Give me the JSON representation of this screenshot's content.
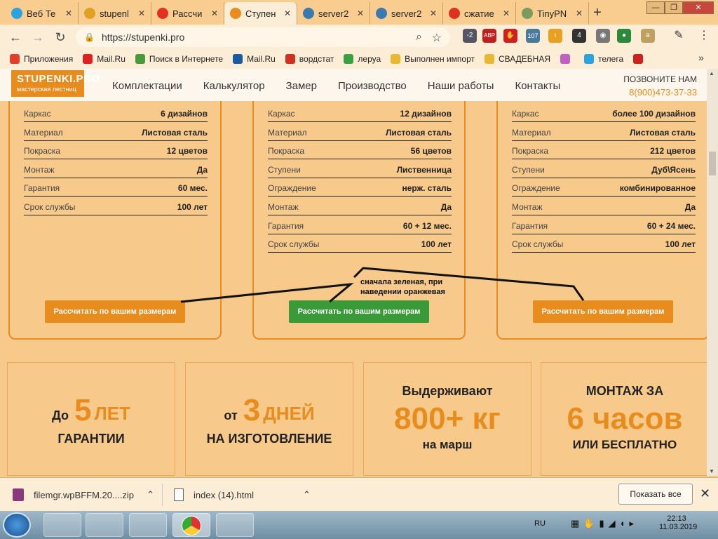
{
  "browser": {
    "tabs": [
      {
        "title": "Веб Те",
        "color": "#2aa3e0"
      },
      {
        "title": "stupenl",
        "color": "#e0a020"
      },
      {
        "title": "Рассчи",
        "color": "#e03020"
      },
      {
        "title": "Ступен",
        "color": "#e88c1e"
      },
      {
        "title": "server2",
        "color": "#3a7ab0"
      },
      {
        "title": "server2",
        "color": "#3a7ab0"
      },
      {
        "title": "сжатие",
        "color": "#e03020"
      },
      {
        "title": "TinyPN",
        "color": "#7a9a60"
      }
    ],
    "active_tab": 3,
    "new_tab": "+",
    "url": "https://stupenki.pro",
    "extension_badges": [
      "-2",
      "ABP",
      "107",
      "4"
    ],
    "bookmarks": [
      {
        "label": "Приложения",
        "color": "#e0402a"
      },
      {
        "label": "Mail.Ru",
        "color": "#e02020"
      },
      {
        "label": "Поиск в Интернете",
        "color": "#4a9a3a"
      },
      {
        "label": "Mail.Ru",
        "color": "#1a5aa0"
      },
      {
        "label": "вордстат",
        "color": "#d03020"
      },
      {
        "label": "леруа",
        "color": "#3aa040"
      },
      {
        "label": "Выполнен импорт",
        "color": "#e8b830"
      },
      {
        "label": "СВАДЕБНАЯ",
        "color": "#e8b830"
      },
      {
        "label": "",
        "color": "#c060c0"
      },
      {
        "label": "телега",
        "color": "#2aa3e0"
      },
      {
        "label": "",
        "color": "#d02020"
      }
    ],
    "more": "»"
  },
  "site": {
    "logo_title": "STUPENKI.PRO",
    "logo_sub": "мастерская лестниц",
    "nav": [
      "Комплектации",
      "Калькулятор",
      "Замер",
      "Производство",
      "Наши работы",
      "Контакты"
    ],
    "phone_label": "ПОЗВОНИТЕ НАМ",
    "phone": "8(900)473-37-33"
  },
  "cards": [
    {
      "rows": [
        {
          "k": "Каркас",
          "v": "6 дизайнов"
        },
        {
          "k": "Материал",
          "v": "Листовая сталь"
        },
        {
          "k": "Покраска",
          "v": "12 цветов"
        },
        {
          "k": "Монтаж",
          "v": "Да"
        },
        {
          "k": "Гарантия",
          "v": "60 мес."
        },
        {
          "k": "Срок службы",
          "v": "100 лет"
        }
      ],
      "button": "Рассчитать по вашим размерам",
      "button_color": "#e88c1e"
    },
    {
      "rows": [
        {
          "k": "Каркас",
          "v": "12 дизайнов"
        },
        {
          "k": "Материал",
          "v": "Листовая сталь"
        },
        {
          "k": "Покраска",
          "v": "56 цветов"
        },
        {
          "k": "Ступени",
          "v": "Лиственница"
        },
        {
          "k": "Ограждение",
          "v": "нерж. сталь"
        },
        {
          "k": "Монтаж",
          "v": "Да"
        },
        {
          "k": "Гарантия",
          "v": "60 + 12 мес."
        },
        {
          "k": "Срок службы",
          "v": "100 лет"
        }
      ],
      "button": "Рассчитать по вашим размерам",
      "button_color": "#3a9a3a"
    },
    {
      "rows": [
        {
          "k": "Каркас",
          "v": "более 100 дизайнов"
        },
        {
          "k": "Материал",
          "v": "Листовая сталь"
        },
        {
          "k": "Покраска",
          "v": "212 цветов"
        },
        {
          "k": "Ступени",
          "v": "Дуб\\Ясень"
        },
        {
          "k": "Ограждение",
          "v": "комбинированное"
        },
        {
          "k": "Монтаж",
          "v": "Да"
        },
        {
          "k": "Гарантия",
          "v": "60 + 24 мес."
        },
        {
          "k": "Срок службы",
          "v": "100 лет"
        }
      ],
      "button": "Рассчитать по вашим размерам",
      "button_color": "#e88c1e"
    }
  ],
  "annotation": "сначала зеленая, при наведении оранжевая",
  "features": [
    {
      "pre": "До",
      "big": "5",
      "big_suffix": "ЛЕТ",
      "line2": "ГАРАНТИИ"
    },
    {
      "pre": "от",
      "big": "3",
      "big_suffix": "ДНЕЙ",
      "line2": "НА ИЗГОТОВЛЕНИЕ"
    },
    {
      "line1": "Выдерживают",
      "big": "800+ кг",
      "line2": "на марш"
    },
    {
      "line1": "МОНТАЖ ЗА",
      "big": "6 часов",
      "line2": "ИЛИ БЕСПЛАТНО"
    }
  ],
  "accent": "#e88c1e",
  "downloads": [
    {
      "name": "filemgr.wpBFFM.20....zip"
    },
    {
      "name": "index (14).html"
    }
  ],
  "show_all": "Показать все",
  "taskbar": {
    "lang": "RU",
    "time": "22:13",
    "date": "11.03.2019"
  }
}
